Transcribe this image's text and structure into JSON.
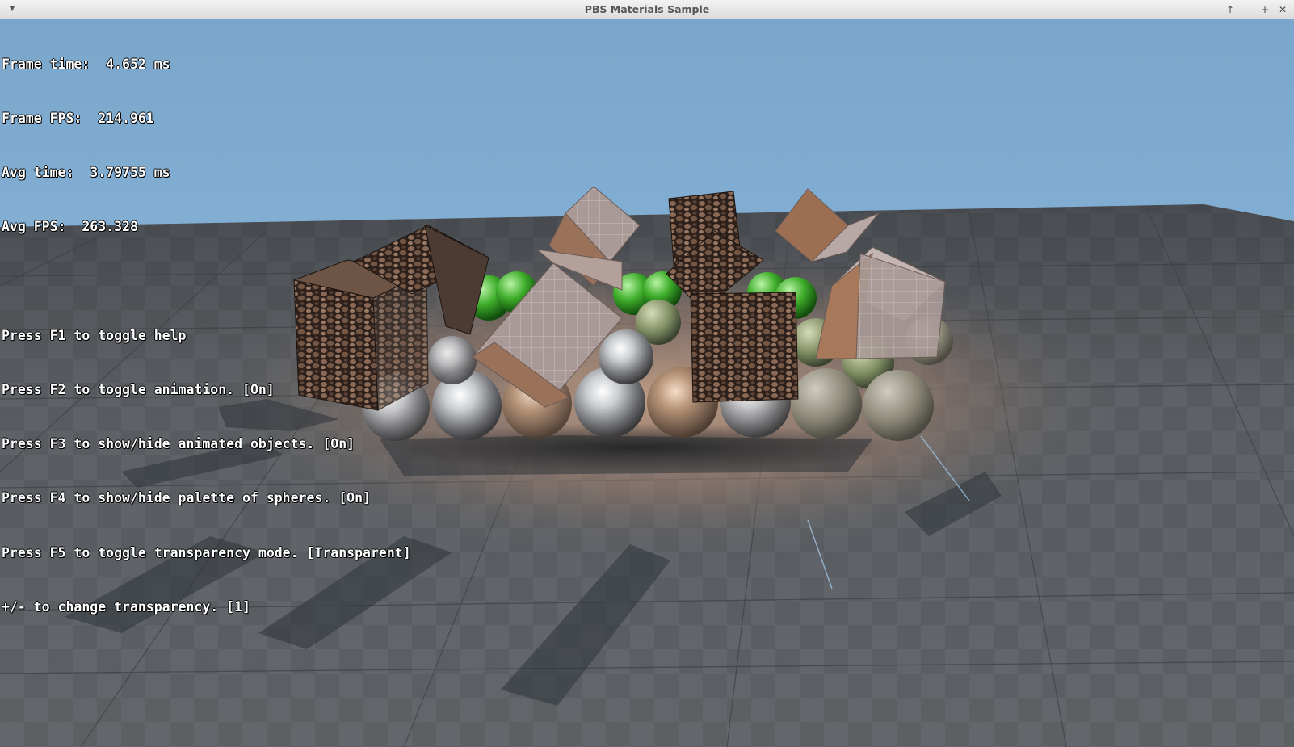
{
  "window": {
    "title": "PBS Materials Sample",
    "menu_icon": "chevron-down-icon",
    "controls": [
      {
        "name": "window-up-button",
        "glyph": "↑",
        "icon": "arrow-up-icon"
      },
      {
        "name": "window-minimize-button",
        "glyph": "–",
        "icon": "minimize-icon"
      },
      {
        "name": "window-maximize-button",
        "glyph": "+",
        "icon": "maximize-icon"
      },
      {
        "name": "window-close-button",
        "glyph": "✕",
        "icon": "close-icon"
      }
    ]
  },
  "stats": {
    "frame_time": "Frame time:  4.652 ms",
    "frame_fps": "Frame FPS:  214.961",
    "avg_time": "Avg time:  3.79755 ms",
    "avg_fps": "Avg FPS:  263.328"
  },
  "help": {
    "f1": "Press F1 to toggle help",
    "f2": "Press F2 to toggle animation. [On]",
    "f3": "Press F3 to show/hide animated objects. [On]",
    "f4": "Press F4 to show/hide palette of spheres. [On]",
    "f5": "Press F5 to toggle transparency mode. [Transparent]",
    "transparency": "+/- to change transparency. [1]"
  },
  "scene": {
    "sky_color": "#7ea9cd",
    "floor_color": "#5f6367",
    "floor_tile_dark": "#55595d",
    "glow_color": "#c4a088",
    "texture_color": "#3a2a22"
  }
}
